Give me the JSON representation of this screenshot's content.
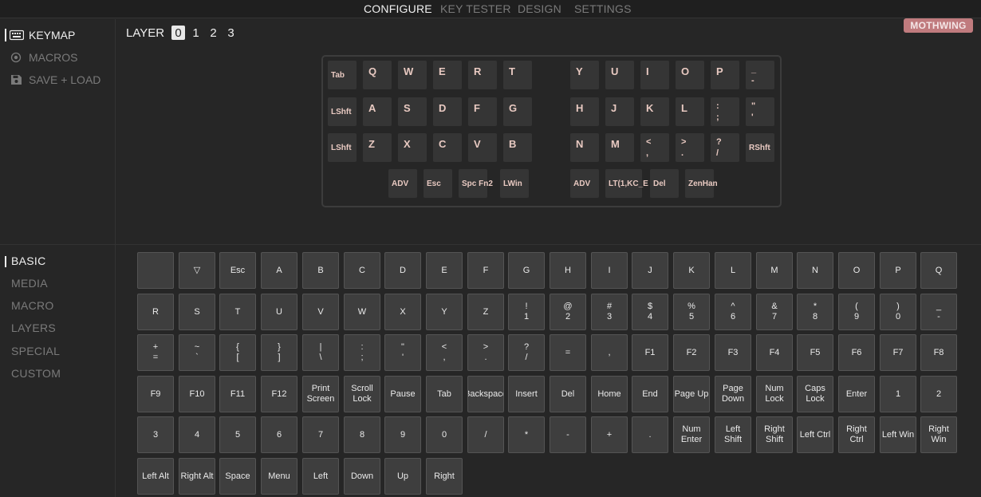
{
  "nav": {
    "tabs": [
      {
        "label": "CONFIGURE",
        "active": true
      },
      {
        "label": "KEY TESTER",
        "active": false
      },
      {
        "label": "DESIGN",
        "active": false
      },
      {
        "label": "SETTINGS",
        "active": false
      }
    ]
  },
  "sidebar": {
    "items": [
      {
        "label": "KEYMAP",
        "icon": "keyboard-icon",
        "active": true
      },
      {
        "label": "MACROS",
        "icon": "record-icon",
        "active": false
      },
      {
        "label": "SAVE + LOAD",
        "icon": "floppy-icon",
        "active": false
      }
    ]
  },
  "layers": {
    "label": "LAYER",
    "items": [
      "0",
      "1",
      "2",
      "3"
    ],
    "active": "0"
  },
  "device_badge": "MOTHWING",
  "keyboard": {
    "left_rows": [
      [
        "Tab",
        "Q",
        "W",
        "E",
        "R",
        "T"
      ],
      [
        "LShft",
        "A",
        "S",
        "D",
        "F",
        "G"
      ],
      [
        "LShft",
        "Z",
        "X",
        "C",
        "V",
        "B"
      ]
    ],
    "right_rows": [
      [
        "Y",
        "U",
        "I",
        "O",
        "P",
        "_\n-"
      ],
      [
        "H",
        "J",
        "K",
        "L",
        ":\n;",
        "\"\n'"
      ],
      [
        "N",
        "M",
        "<\n,",
        ">\n.",
        "?\n/",
        "RShft"
      ]
    ],
    "left_thumbs": [
      "ADV",
      "Esc",
      "Spc Fn2",
      "LWin"
    ],
    "right_thumbs": [
      "ADV",
      "LT(1,KC_E",
      "Del",
      "ZenHan"
    ]
  },
  "categories": {
    "items": [
      "BASIC",
      "MEDIA",
      "MACRO",
      "LAYERS",
      "SPECIAL",
      "CUSTOM"
    ],
    "active": "BASIC"
  },
  "key_palette": [
    "",
    "▽",
    "Esc",
    "A",
    "B",
    "C",
    "D",
    "E",
    "F",
    "G",
    "H",
    "I",
    "J",
    "K",
    "L",
    "M",
    "N",
    "O",
    "P",
    "Q",
    "R",
    "S",
    "T",
    "U",
    "V",
    "W",
    "X",
    "Y",
    "Z",
    "!\n1",
    "@\n2",
    "#\n3",
    "$\n4",
    "%\n5",
    "^\n6",
    "&\n7",
    "*\n8",
    "(\n9",
    ")\n0",
    "_\n-",
    "+\n=",
    "~\n`",
    "{\n[",
    "}\n]",
    "|\n\\",
    ":\n;",
    "\"\n'",
    "<\n,",
    ">\n.",
    "?\n/",
    "=",
    ",",
    "F1",
    "F2",
    "F3",
    "F4",
    "F5",
    "F6",
    "F7",
    "F8",
    "F9",
    "F10",
    "F11",
    "F12",
    "Print\nScreen",
    "Scroll\nLock",
    "Pause",
    "Tab",
    "Backspace",
    "Insert",
    "Del",
    "Home",
    "End",
    "Page Up",
    "Page\nDown",
    "Num\nLock",
    "Caps\nLock",
    "Enter",
    "1",
    "2",
    "3",
    "4",
    "5",
    "6",
    "7",
    "8",
    "9",
    "0",
    "/",
    "*",
    "-",
    "+",
    ".",
    "Num\nEnter",
    "Left\nShift",
    "Right\nShift",
    "Left Ctrl",
    "Right\nCtrl",
    "Left Win",
    "Right\nWin",
    "Left Alt",
    "Right Alt",
    "Space",
    "Menu",
    "Left",
    "Down",
    "Up",
    "Right"
  ],
  "colors": {
    "background": "#262626",
    "key_legend": "#e8c9c1",
    "badge": "#c07b7e"
  }
}
